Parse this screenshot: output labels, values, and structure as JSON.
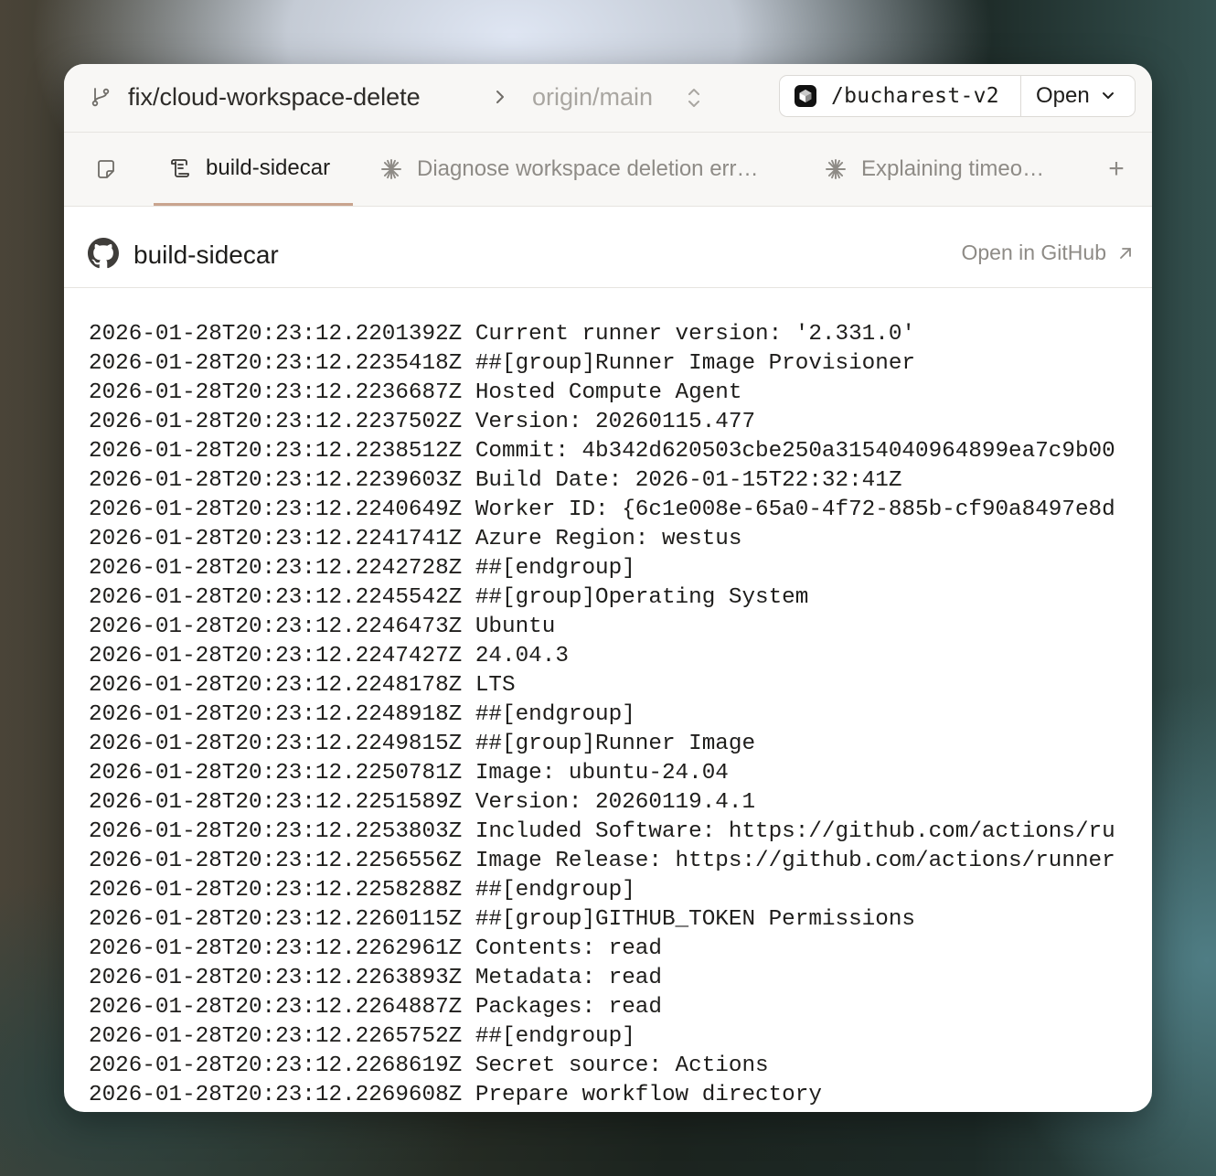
{
  "titlebar": {
    "branch": "fix/cloud-workspace-delete",
    "base_branch": "origin/main",
    "workspace_path": "/bucharest-v2",
    "open_label": "Open"
  },
  "tabs": [
    {
      "label": "",
      "icon": "note-icon"
    },
    {
      "label": "build-sidecar",
      "icon": "log-icon",
      "active": true
    },
    {
      "label": "Diagnose workspace deletion err…",
      "icon": "sparkle-icon"
    },
    {
      "label": "Explaining timeo…",
      "icon": "sparkle-icon"
    }
  ],
  "content": {
    "title": "build-sidecar",
    "github_link": "Open in GitHub"
  },
  "log_lines": [
    "2026-01-28T20:23:12.2201392Z Current runner version: '2.331.0'",
    "2026-01-28T20:23:12.2235418Z ##[group]Runner Image Provisioner",
    "2026-01-28T20:23:12.2236687Z Hosted Compute Agent",
    "2026-01-28T20:23:12.2237502Z Version: 20260115.477",
    "2026-01-28T20:23:12.2238512Z Commit: 4b342d620503cbe250a3154040964899ea7c9b00",
    "2026-01-28T20:23:12.2239603Z Build Date: 2026-01-15T22:32:41Z",
    "2026-01-28T20:23:12.2240649Z Worker ID: {6c1e008e-65a0-4f72-885b-cf90a8497e8d",
    "2026-01-28T20:23:12.2241741Z Azure Region: westus",
    "2026-01-28T20:23:12.2242728Z ##[endgroup]",
    "2026-01-28T20:23:12.2245542Z ##[group]Operating System",
    "2026-01-28T20:23:12.2246473Z Ubuntu",
    "2026-01-28T20:23:12.2247427Z 24.04.3",
    "2026-01-28T20:23:12.2248178Z LTS",
    "2026-01-28T20:23:12.2248918Z ##[endgroup]",
    "2026-01-28T20:23:12.2249815Z ##[group]Runner Image",
    "2026-01-28T20:23:12.2250781Z Image: ubuntu-24.04",
    "2026-01-28T20:23:12.2251589Z Version: 20260119.4.1",
    "2026-01-28T20:23:12.2253803Z Included Software: https://github.com/actions/ru",
    "2026-01-28T20:23:12.2256556Z Image Release: https://github.com/actions/runner",
    "2026-01-28T20:23:12.2258288Z ##[endgroup]",
    "2026-01-28T20:23:12.2260115Z ##[group]GITHUB_TOKEN Permissions",
    "2026-01-28T20:23:12.2262961Z Contents: read",
    "2026-01-28T20:23:12.2263893Z Metadata: read",
    "2026-01-28T20:23:12.2264887Z Packages: read",
    "2026-01-28T20:23:12.2265752Z ##[endgroup]",
    "2026-01-28T20:23:12.2268619Z Secret source: Actions",
    "2026-01-28T20:23:12.2269608Z Prepare workflow directory"
  ]
}
